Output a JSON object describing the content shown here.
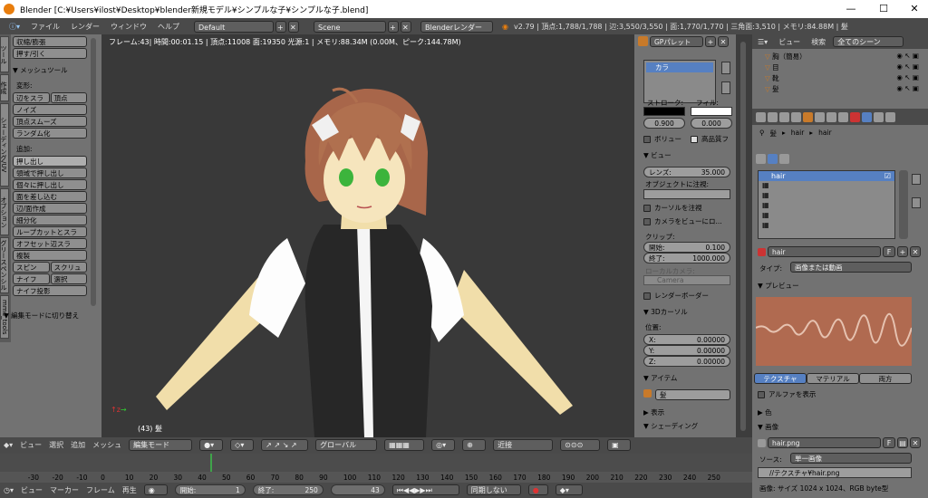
{
  "window": {
    "title": "Blender [C:¥Users¥ilost¥Desktop¥blender新規モデル¥シンプルな子¥シンプルな子.blend]",
    "min": "—",
    "max": "☐",
    "close": "✕"
  },
  "menu": {
    "items": [
      "ファイル",
      "レンダー",
      "ウィンドウ",
      "ヘルプ"
    ],
    "layout": "Default",
    "scene": "Scene",
    "engine": "Blenderレンダー",
    "stats": "v2.79 | 頂点:1,788/1,788 | 辺:3,550/3,550 | 面:1,770/1,770 | 三角面:3,510 | メモリ:84.88M | 髪"
  },
  "toolshelf": {
    "top_buttons": [
      "収縮/膨張",
      "押す/引く"
    ],
    "mesh_tools": "▼ メッシュツール",
    "deform_label": "変形:",
    "deform": [
      "辺をスラ",
      "頂点",
      "ノイズ",
      "頂点スムーズ",
      "ランダム化"
    ],
    "add_label": "追加:",
    "add": [
      "押し出し",
      "領域で押し出し",
      "個々に押し出し",
      "面を差し込む",
      "辺/面作成",
      "細分化",
      "ループカットとスラ",
      "オフセット辺スラ",
      "複製"
    ],
    "pair1": [
      "スピン",
      "スクリュ"
    ],
    "pair2": [
      "ナイフ",
      "選択"
    ],
    "knife_proj": "ナイフ投影",
    "editmode_toggle": "▼ 編集モードに切り替え",
    "tabs": [
      "ツール",
      "作成",
      "シェーディング/UV",
      "オプション",
      "グリースペンシル",
      "mmd_tools"
    ]
  },
  "viewport": {
    "info": "フレーム:43| 時間:00:01.15 | 頂点:11008 面:19350 光源:1 | メモリ:88.34M (0.00M、ピーク:144.78M)",
    "object_label": "(43) 髪"
  },
  "npanel": {
    "gp_palette": "GPパレット",
    "gp_layer": "カラ",
    "stroke_label": "ストローク:",
    "fill_label": "フィル:",
    "stroke_value": "0.900",
    "fill_value": "0.000",
    "volume": "ボリュー",
    "hq": "高品質フ",
    "view_header": "▼ ビュー",
    "lens_label": "レンズ:",
    "lens_value": "35.000",
    "lock_label": "オブジェクトに注視:",
    "lock_cursor": "カーソルを注視",
    "lock_camera": "カメラをビューにロ...",
    "clip_label": "クリップ:",
    "clip_start_label": "開始:",
    "clip_start": "0.100",
    "clip_end_label": "終了:",
    "clip_end": "1000.000",
    "local_cam_label": "ローカルカメラ:",
    "camera": "Camera",
    "render_border": "レンダーボーダー",
    "cursor_header": "▼ 3Dカーソル",
    "location_label": "位置:",
    "x_label": "X:",
    "y_label": "Y:",
    "z_label": "Z:",
    "x": "0.00000",
    "y": "0.00000",
    "z": "0.00000",
    "item_header": "▼ アイテム",
    "item_name": "髪",
    "display_header": "▶ 表示",
    "shading_header": "▼ シェーディング"
  },
  "outliner": {
    "view": "ビュー",
    "search": "検索",
    "scene_filter": "全てのシーン",
    "rows": [
      "胸（簡易）",
      "目",
      "靴",
      "髪"
    ]
  },
  "props": {
    "breadcrumb": [
      "髪",
      "hair",
      "hair"
    ],
    "slots": [
      "hair",
      "",
      "",
      "",
      "",
      "",
      ""
    ],
    "tex_name": "hair",
    "fake": "F",
    "type_label": "タイプ:",
    "type_value": "画像または動画",
    "preview_header": "▼ プレビュー",
    "tab_texture": "テクスチャ",
    "tab_material": "マテリアル",
    "tab_both": "両方",
    "show_alpha": "アルファを表示",
    "color_header": "▶ 色",
    "image_header": "▼ 画像",
    "image_name": "hair.png",
    "source_label": "ソース:",
    "source_value": "単一画像",
    "path": "//テクスチャ¥hair.png",
    "image_info": "画像: サイズ 1024 x 1024、RGB byte型"
  },
  "bottombar": {
    "menus": [
      "ビュー",
      "選択",
      "追加",
      "メッシュ"
    ],
    "mode": "編集モード",
    "orientation": "グローバル",
    "snap": "近接"
  },
  "timeline": {
    "ticks": [
      "-30",
      "-20",
      "-10",
      "0",
      "10",
      "20",
      "30",
      "40",
      "50",
      "60",
      "70",
      "80",
      "90",
      "100",
      "110",
      "120",
      "130",
      "140",
      "150",
      "160",
      "170",
      "180",
      "190",
      "200",
      "210",
      "220",
      "230",
      "240",
      "250"
    ],
    "current": 43,
    "tick_min": -40,
    "tick_max": 255
  },
  "tlheader": {
    "menus": [
      "ビュー",
      "マーカー",
      "フレーム",
      "再生"
    ],
    "start_label": "開始:",
    "start": "1",
    "end_label": "終了:",
    "end": "250",
    "frame": "43",
    "sync": "同期しない"
  },
  "colors": {
    "accent": "#5680c2",
    "header": "#4a4a4a",
    "panel": "#727272",
    "viewport": "#393939"
  }
}
